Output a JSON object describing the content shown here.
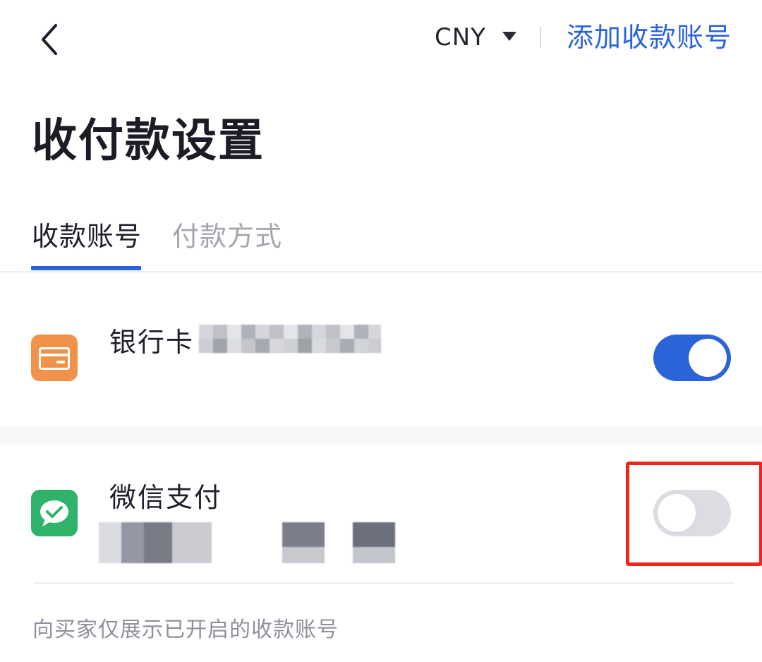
{
  "header": {
    "back_icon": "chevron-left-icon",
    "currency": "CNY",
    "currency_caret_icon": "caret-down-icon",
    "add_account_label": "添加收款账号"
  },
  "page": {
    "title": "收付款设置"
  },
  "tabs": [
    {
      "label": "收款账号",
      "active": true
    },
    {
      "label": "付款方式",
      "active": false
    }
  ],
  "accounts": [
    {
      "name": "银行卡",
      "icon": "bank-card-icon",
      "enabled": true
    },
    {
      "name": "微信支付",
      "icon": "wechat-pay-icon",
      "enabled": false
    }
  ],
  "footer_note": "向买家仅展示已开启的收款账号",
  "colors": {
    "accent": "#2a64d8",
    "bank_icon": "#f1924a",
    "wechat_icon": "#2fb26a",
    "highlight": "#f0261d",
    "toggle_off": "#dcdde3"
  }
}
